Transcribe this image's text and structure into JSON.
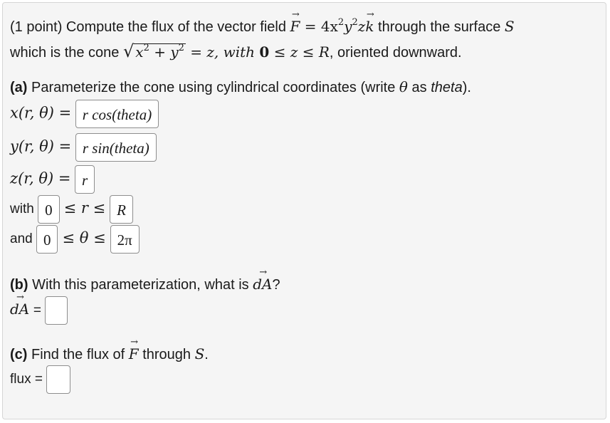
{
  "problem": {
    "intro_1": "(1 point) Compute the flux of the vector field ",
    "F_expr_eq": " = 4x",
    "F_after": "y",
    "F_tail": "z",
    "k": "k",
    "through": " through the surface ",
    "S": "S",
    "intro_2": "which is the cone ",
    "cone_rhs": " = z, with ",
    "zero": "0",
    "bounds": " ≤ z ≤ ",
    "R": "R",
    "oriented": ", oriented downward."
  },
  "part_a": {
    "label": "(a)",
    "text_pre": " Parameterize the cone using cylindrical coordinates (write ",
    "theta": "θ",
    "text_as": " as ",
    "theta_word": "theta",
    "text_end": ")."
  },
  "param": {
    "x_lhs": "x(r, θ) =",
    "x_answer": "r cos(theta)",
    "y_lhs": "y(r, θ) =",
    "y_answer": "r sin(theta)",
    "z_lhs": "z(r, θ) =",
    "z_answer": "r",
    "with_label": "with",
    "r_lower": "0",
    "r_mid": "≤ r ≤",
    "r_upper": "R",
    "and_label": "and",
    "theta_lower": "0",
    "theta_mid": "≤ θ ≤",
    "theta_upper": "2π"
  },
  "part_b": {
    "label": "(b)",
    "text": " With this parameterization, what is ",
    "dA": "dA",
    "q": "?",
    "answer_label": "=",
    "answer_value": ""
  },
  "part_c": {
    "label": "(c)",
    "text": " Find the flux of ",
    "F": "F",
    "through": " through ",
    "S": "S",
    "period": ".",
    "flux_label": "flux =",
    "answer_value": ""
  }
}
